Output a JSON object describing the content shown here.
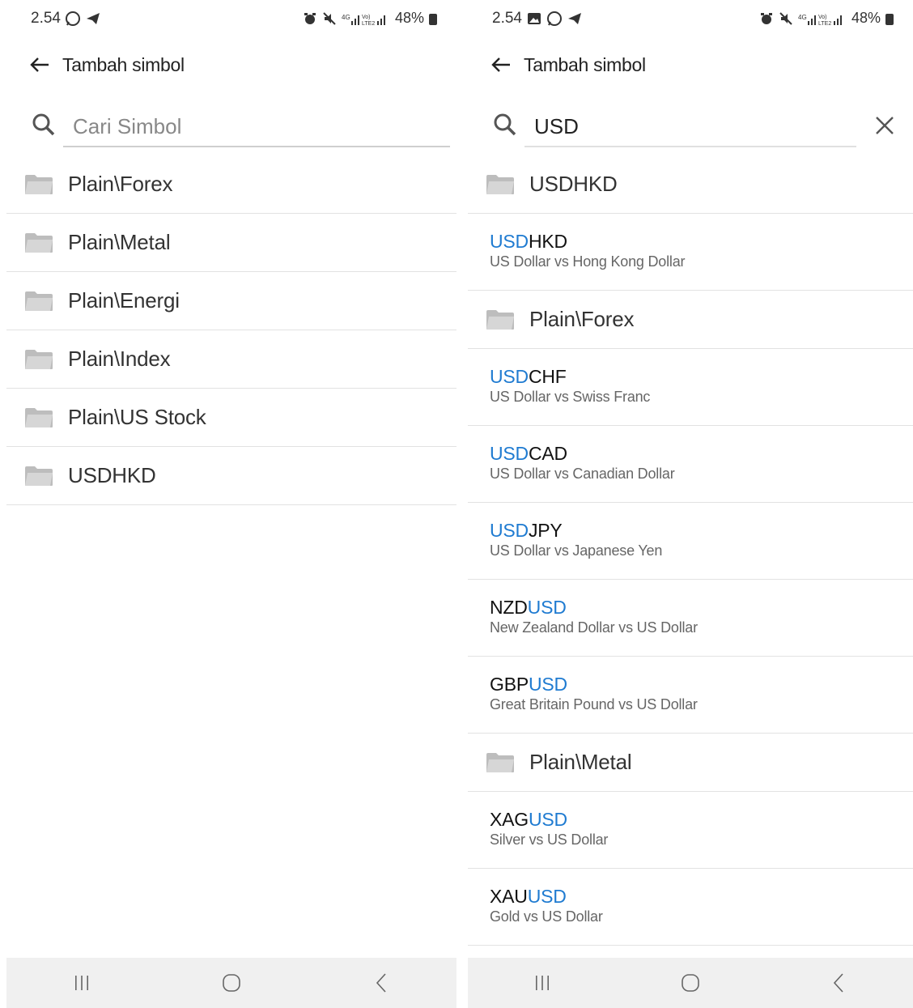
{
  "left": {
    "status": {
      "time": "2.54",
      "battery": "48%"
    },
    "appbar": {
      "title": "Tambah simbol"
    },
    "search": {
      "placeholder": "Cari Simbol",
      "value": ""
    },
    "folders": [
      {
        "label": "Plain\\Forex"
      },
      {
        "label": "Plain\\Metal"
      },
      {
        "label": "Plain\\Energi"
      },
      {
        "label": "Plain\\Index"
      },
      {
        "label": "Plain\\US Stock"
      },
      {
        "label": "USDHKD"
      }
    ]
  },
  "right": {
    "status": {
      "time": "2.54",
      "battery": "48%"
    },
    "appbar": {
      "title": "Tambah simbol"
    },
    "search": {
      "placeholder": "Cari Simbol",
      "value": "USD"
    },
    "groups": [
      {
        "folder": "USDHKD",
        "symbols": [
          {
            "pre": "",
            "match": "USD",
            "post": "HKD",
            "desc": "US Dollar vs Hong Kong Dollar"
          }
        ]
      },
      {
        "folder": "Plain\\Forex",
        "symbols": [
          {
            "pre": "",
            "match": "USD",
            "post": "CHF",
            "desc": "US Dollar vs Swiss Franc"
          },
          {
            "pre": "",
            "match": "USD",
            "post": "CAD",
            "desc": "US Dollar vs Canadian Dollar"
          },
          {
            "pre": "",
            "match": "USD",
            "post": "JPY",
            "desc": "US Dollar vs Japanese Yen"
          },
          {
            "pre": "NZD",
            "match": "USD",
            "post": "",
            "desc": "New Zealand Dollar vs US Dollar"
          },
          {
            "pre": "GBP",
            "match": "USD",
            "post": "",
            "desc": "Great Britain Pound vs US Dollar"
          }
        ]
      },
      {
        "folder": "Plain\\Metal",
        "symbols": [
          {
            "pre": "XAG",
            "match": "USD",
            "post": "",
            "desc": "Silver vs US Dollar"
          },
          {
            "pre": "XAU",
            "match": "USD",
            "post": "",
            "desc": "Gold vs US Dollar"
          }
        ]
      }
    ]
  },
  "colors": {
    "highlight": "#1f7bd1",
    "folder": "#bdbdbd",
    "navbar": "#f0f0f0"
  },
  "icons": [
    "arrow-left-icon",
    "search-icon",
    "close-icon",
    "folder-icon",
    "whatsapp-icon",
    "telegram-icon",
    "gallery-icon",
    "alarm-icon",
    "mute-icon",
    "signal-icon",
    "battery-icon",
    "recents-icon",
    "home-icon",
    "back-nav-icon"
  ]
}
